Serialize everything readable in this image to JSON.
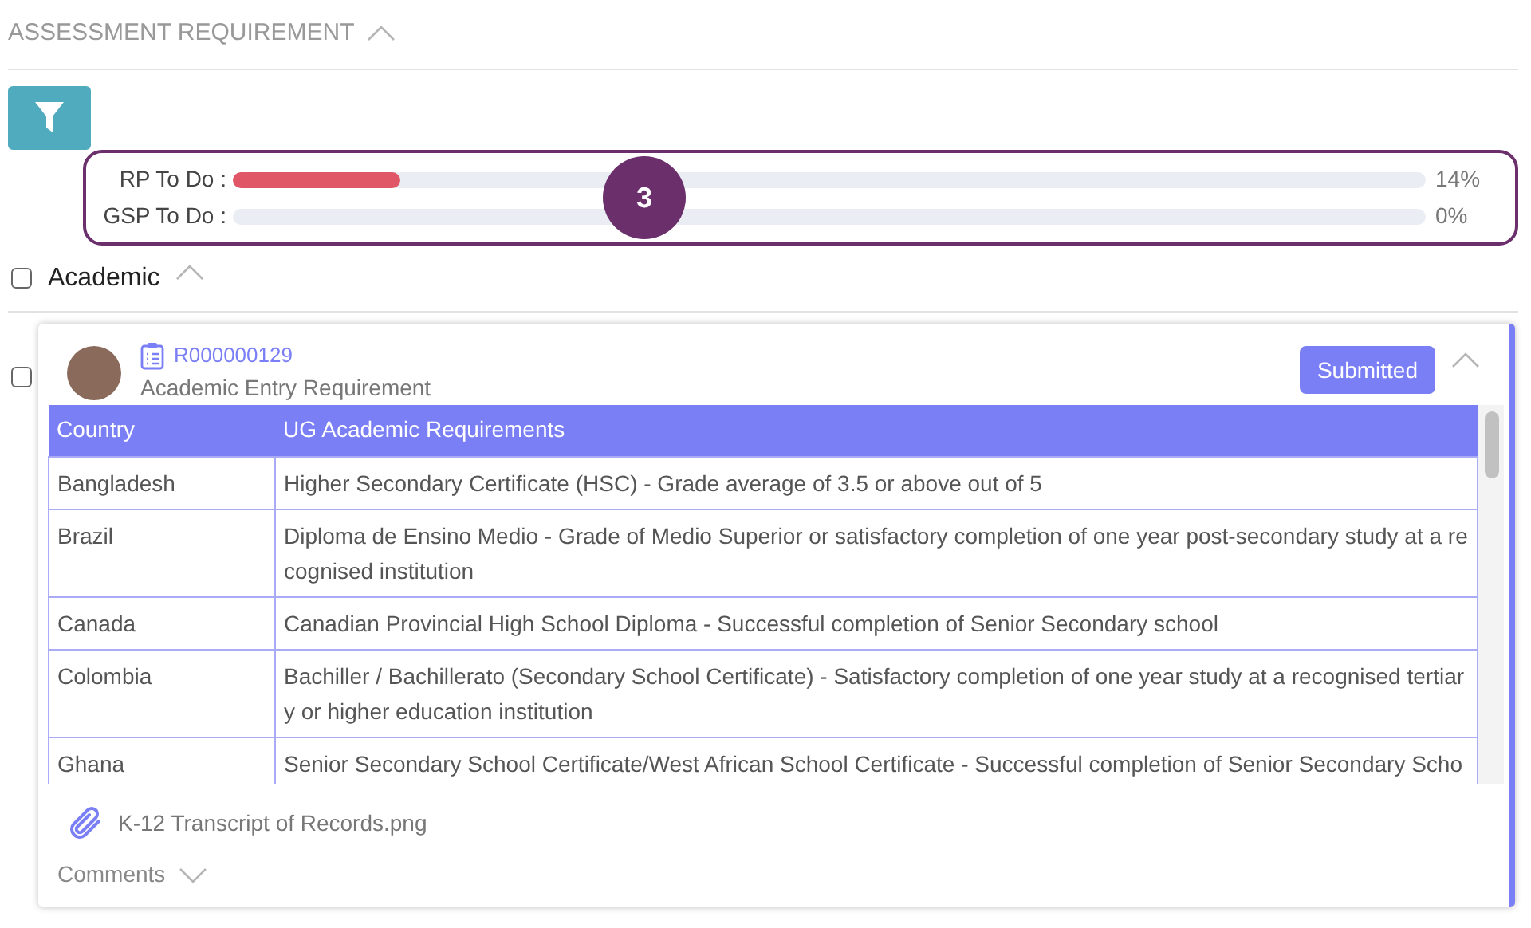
{
  "section": {
    "title": "ASSESSMENT REQUIREMENT",
    "expanded": true
  },
  "progress": [
    {
      "label": "RP To Do :",
      "level": 0.14,
      "reading": "14%"
    },
    {
      "label": "GSP To Do :",
      "level": 0,
      "reading": "0%"
    }
  ],
  "step_badge": "3",
  "group": {
    "label": "Academic",
    "checked": false,
    "expanded": true
  },
  "card": {
    "checked": false,
    "id": "R000000129",
    "title": "Academic Entry Requirement",
    "status": "Submitted",
    "expanded": true,
    "table": {
      "columns": [
        "Country",
        "UG Academic Requirements"
      ],
      "rows": [
        [
          "Bangladesh",
          "Higher Secondary Certificate (HSC) - Grade average of 3.5 or above out of 5"
        ],
        [
          "Brazil",
          "Diploma de Ensino Medio - Grade of Medio Superior or satisfactory completion of one year post-secondary study at a recognised institution"
        ],
        [
          "Canada",
          "Canadian Provincial High School Diploma - Successful completion of Senior Secondary school"
        ],
        [
          "Colombia",
          "Bachiller / Bachillerato (Secondary School Certificate) - Satisfactory completion of one year study at a recognised tertiary or higher education institution"
        ],
        [
          "Ghana",
          "Senior Secondary School Certificate/West African School Certificate - Successful completion of Senior Secondary Scho"
        ]
      ]
    },
    "attachment": "K-12 Transcript of Records.png",
    "comments": {
      "label": "Comments",
      "expanded": false
    }
  }
}
